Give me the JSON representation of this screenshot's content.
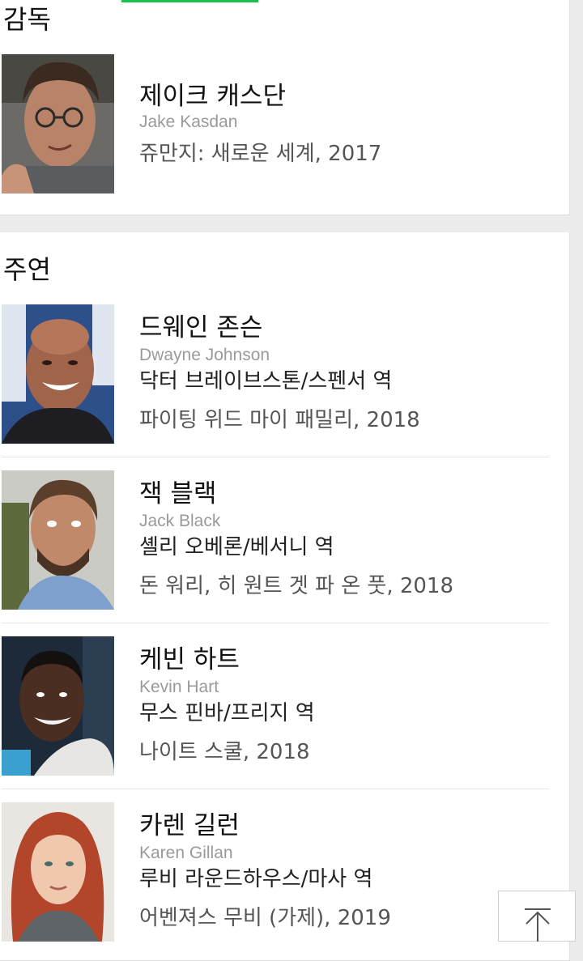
{
  "accent_color": "#19c24a",
  "director_section": {
    "title": "감독",
    "people": [
      {
        "name_ko": "제이크 캐스단",
        "name_en": "Jake Kasdan",
        "work": "쥬만지: 새로운 세계, 2017",
        "photo_icon": "portrait-photo"
      }
    ]
  },
  "cast_section": {
    "title": "주연",
    "people": [
      {
        "name_ko": "드웨인 존슨",
        "name_en": "Dwayne Johnson",
        "role": "닥터 브레이브스톤/스펜서 역",
        "work": "파이팅 위드 마이 패밀리, 2018",
        "photo_icon": "portrait-photo"
      },
      {
        "name_ko": "잭 블랙",
        "name_en": "Jack Black",
        "role": "셸리 오베론/베서니 역",
        "work": "돈 워리, 히 원트 겟 파 온 풋, 2018",
        "photo_icon": "portrait-photo"
      },
      {
        "name_ko": "케빈 하트",
        "name_en": "Kevin Hart",
        "role": "무스 핀바/프리지 역",
        "work": "나이트 스쿨, 2018",
        "photo_icon": "portrait-photo"
      },
      {
        "name_ko": "카렌 길런",
        "name_en": "Karen Gillan",
        "role": "루비 라운드하우스/마사 역",
        "work": "어벤져스 무비 (가제), 2019",
        "photo_icon": "portrait-photo"
      }
    ]
  },
  "scroll_top_button": {
    "icon": "arrow-up-icon"
  }
}
